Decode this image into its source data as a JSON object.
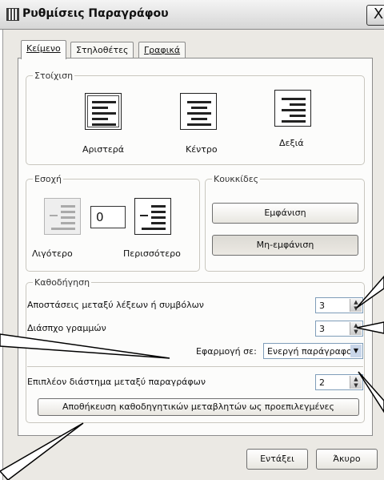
{
  "window": {
    "title": "Ρυθμίσεις Παραγράφου",
    "close": "X"
  },
  "tabs": [
    {
      "label": "Κείμενο",
      "active": true
    },
    {
      "label": "Στηλοθέτες",
      "active": false
    },
    {
      "label": "Γραφικά",
      "active": false
    }
  ],
  "alignment": {
    "legend": "Στοίχιση",
    "options": [
      {
        "label": "Αριστερά",
        "selected": true
      },
      {
        "label": "Κέντρο",
        "selected": false
      },
      {
        "label": "Δεξιά",
        "selected": false
      }
    ]
  },
  "indent": {
    "legend": "Εσοχή",
    "value": "0",
    "decrease_label": "Λιγότερο",
    "increase_label": "Περισσότερο"
  },
  "bullets": {
    "legend": "Κουκκίδες",
    "show_label": "Εμφάνιση",
    "hide_label": "Μη-εμφάνιση"
  },
  "justification": {
    "legend": "Καθοδήγηση",
    "word_spacing_label": "Αποστάσεις μεταξύ λέξεων ή συμβόλων",
    "word_spacing_value": "3",
    "line_spacing_label": "Διάσπχο γραμμών",
    "line_spacing_value": "3",
    "apply_to_label": "Εφαρμογή σε:",
    "apply_to_value": "Ενεργή παράγραφο",
    "paragraph_spacing_label": "Επιπλέον διάστημα μεταξύ παραγράφων",
    "paragraph_spacing_value": "2",
    "save_defaults_label": "Αποθήκευση καθοδηγητικών μεταβλητών ως προεπιλεγμένες"
  },
  "footer": {
    "ok_label": "Εντάξει",
    "cancel_label": "Άκυρο"
  }
}
